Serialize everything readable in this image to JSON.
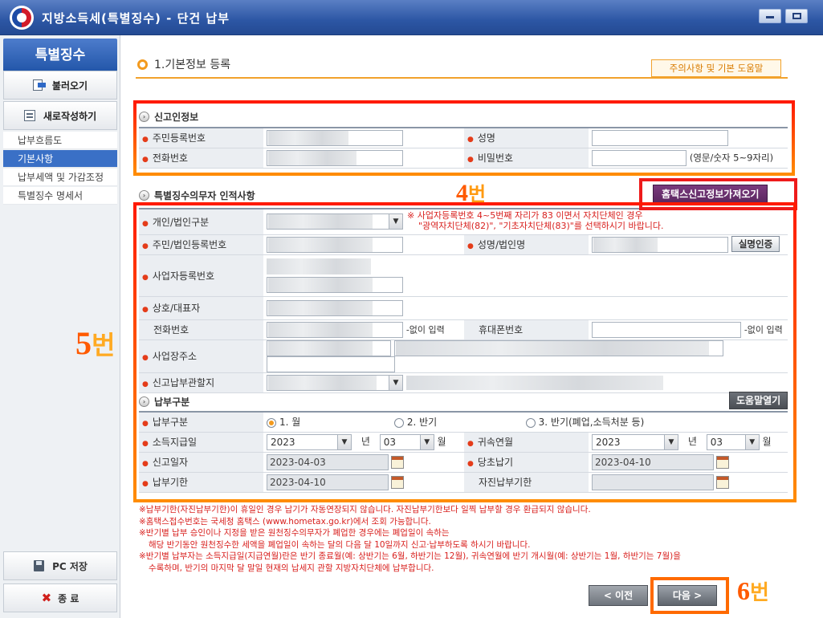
{
  "window": {
    "title": "지방소득세(특별징수) - 단건 납부"
  },
  "sidebar": {
    "header": "특별징수",
    "load_button": "불러오기",
    "new_button": "새로작성하기",
    "items": [
      {
        "label": "납부흐름도",
        "active": false
      },
      {
        "label": "기본사항",
        "active": true
      },
      {
        "label": "납부세액 및 가감조정",
        "active": false
      },
      {
        "label": "특별징수 명세서",
        "active": false
      }
    ],
    "pc_save": "PC 저장",
    "exit": "종 료"
  },
  "page": {
    "title": "1.기본정보 등록",
    "help_button": "주의사항 및 기본 도움말"
  },
  "reporter": {
    "section_title": "신고인정보",
    "rrn_label": "주민등록번호",
    "name_label": "성명",
    "phone_label": "전화번호",
    "password_label": "비밀번호",
    "password_hint": "(영문/숫자 5~9자리)"
  },
  "withholder": {
    "section_title": "특별징수의무자 인적사항",
    "fetch_button": "홈택스신고정보가져오기",
    "type_label": "개인/법인구분",
    "warning_line1": "※ 사업자등록번호 4~5번째 자리가 83 이면서 자치단체인 경우",
    "warning_line2": "\"광역자치단체(82)\", \"기초자치단체(83)\"를 선택하시기 바랍니다.",
    "id_label": "주민/법인등록번호",
    "corp_name_label": "성명/법인명",
    "verify_button": "실명인증",
    "bizno_label": "사업자등록번호",
    "company_label": "상호/대표자",
    "tel_label": "전화번호",
    "no_dash": "-없이 입력",
    "mobile_label": "휴대폰번호",
    "address_label": "사업장주소",
    "office_label": "신고납부관할지"
  },
  "payment": {
    "section_title": "납부구분",
    "help_open_button": "도움말열기",
    "type_label": "납부구분",
    "options": [
      "1. 월",
      "2. 반기",
      "3. 반기(폐업,소득처분 등)"
    ],
    "selected_index": 0,
    "income_date_label": "소득지급일",
    "year_value": "2023",
    "year_unit": "년",
    "month_value": "03",
    "month_unit": "월",
    "attrib_label": "귀속연월",
    "attrib_year": "2023",
    "attrib_month": "03",
    "report_date_label": "신고일자",
    "report_date": "2023-04-03",
    "orig_due_label": "당초납기",
    "orig_due": "2023-04-10",
    "due_label": "납부기한",
    "due_date": "2023-04-10",
    "self_due_label": "자진납부기한",
    "self_due": ""
  },
  "notes": [
    "※납부기한(자진납부기한)이 휴일인 경우 납기가 자동연장되지 않습니다. 자진납부기한보다 일찍 납부할 경우 환급되지 않습니다.",
    "※홈택스접수번호는 국세청 홈택스 (www.hometax.go.kr)에서 조회 가능합니다.",
    "※반기별 납부 승인이나 지정을 받은 원천징수의무자가 폐업한 경우에는 폐업일이 속하는",
    "해당 반기동안 원천징수한 세액을 폐업일이 속하는 달의 다음 달 10일까지 신고·납부하도록 하시기 바랍니다.",
    "※반기별 납부자는 소득지급일(지급연월)란은 반기 종료월(예: 상반기는 6월, 하반기는 12월), 귀속연월에 반기 개시월(예: 상반기는 1월, 하반기는 7월)을",
    "수록하며, 반기의 마지막 달 말일 현재의 납세지 관할 지방자치단체에 납부합니다."
  ],
  "nav": {
    "prev": "< 이전",
    "next": "다음 >"
  },
  "annotations": {
    "label4": "4번",
    "label5": "5번",
    "label6": "6번",
    "num4": "4",
    "suffix4": "번",
    "num5": "5",
    "suffix5": "번",
    "num6": "6",
    "suffix6": "번"
  }
}
